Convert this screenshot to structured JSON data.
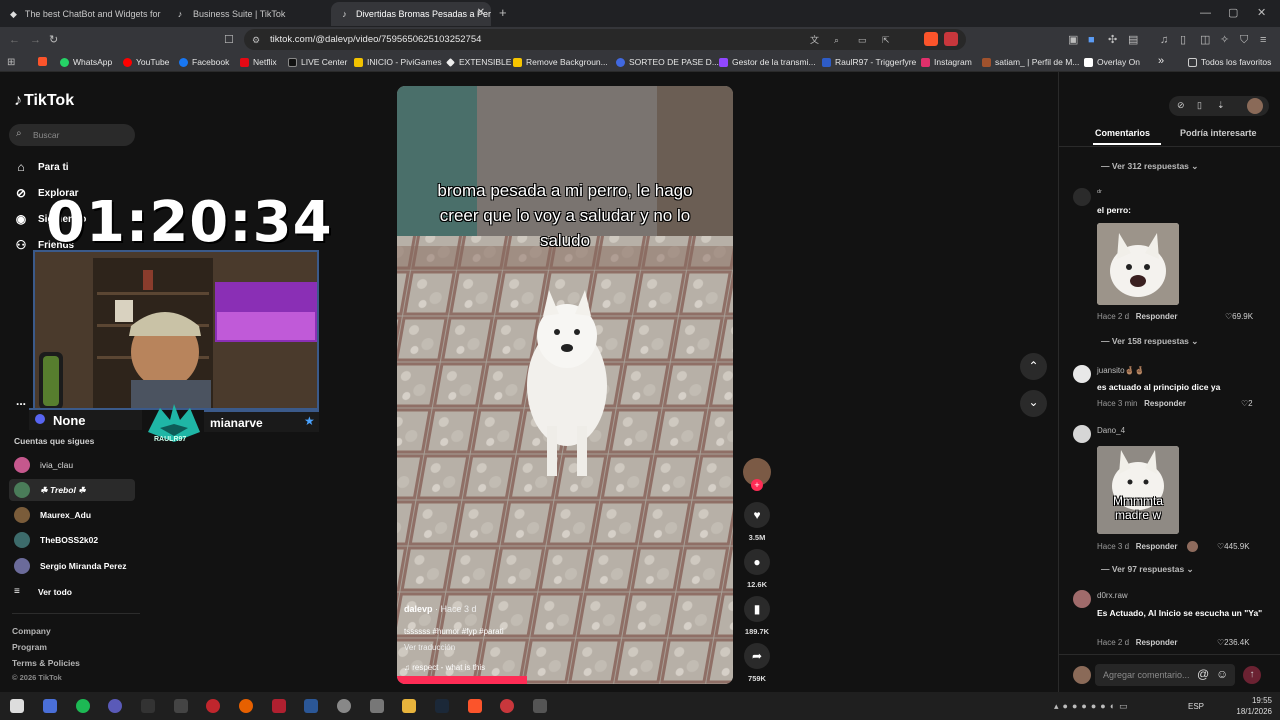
{
  "browser": {
    "tabs": [
      {
        "title": "The best ChatBot and Widgets for Ki",
        "icon": "diamond-icon"
      },
      {
        "title": "Business Suite | TikTok",
        "icon": "tiktok-icon"
      },
      {
        "title": "Divertidas Bromas Pesadas a Per",
        "icon": "tiktok-icon"
      }
    ],
    "new_tab": "+",
    "url": "tiktok.com/@dalevp/video/7595650625103252754",
    "bookmarks": [
      {
        "label": "WhatsApp",
        "color": "#25d366"
      },
      {
        "label": "YouTube",
        "color": "#ff0000"
      },
      {
        "label": "Facebook",
        "color": "#1877f2"
      },
      {
        "label": "Netflix",
        "color": "#e50914"
      },
      {
        "label": "LIVE Center",
        "color": "#000000"
      },
      {
        "label": "INICIO - PiviGames",
        "color": "#f2c200"
      },
      {
        "label": "EXTENSIBLE",
        "color": "#ffffff"
      },
      {
        "label": "Remove Backgroun...",
        "color": "#f7c500"
      },
      {
        "label": "SORTEO DE PASE D...",
        "color": "#4169e1"
      },
      {
        "label": "Gestor de la transmi...",
        "color": "#9147ff"
      },
      {
        "label": "RaulR97 - Triggerfyre",
        "color": "#2e5cc7"
      },
      {
        "label": "Instagram",
        "color": "#e1306c"
      },
      {
        "label": "satiam_ | Perfil de M...",
        "color": "#a0522d"
      },
      {
        "label": "Overlay On",
        "color": "#ffffff"
      }
    ],
    "bookmarks_overflow": "»",
    "all_favorites": "Todos los favoritos"
  },
  "sidebar": {
    "logo": "TikTok",
    "search_placeholder": "Buscar",
    "nav": [
      {
        "label": "Para ti",
        "icon": "home-icon"
      },
      {
        "label": "Explorar",
        "icon": "compass-icon"
      },
      {
        "label": "Siguiendo",
        "icon": "following-icon"
      },
      {
        "label": "Friends",
        "icon": "friends-icon"
      }
    ],
    "more": "...",
    "following_header": "Cuentas que sigues",
    "following": [
      {
        "name": "ivia_clau",
        "color": "#c5588d"
      },
      {
        "name": "☘ Trebol ☘",
        "color": "#4a7c59"
      },
      {
        "name": "Maurex_Adu",
        "color": "#7a5c3a"
      },
      {
        "name": "TheBOSS2k02",
        "color": "#3d6b6b"
      },
      {
        "name": "Sergio Miranda Perez",
        "color": "#6b6b9a"
      }
    ],
    "see_all": "Ver todo",
    "footer": [
      "Company",
      "Program",
      "Terms & Policies"
    ],
    "copyright": "© 2026 TikTok"
  },
  "overlay": {
    "timer": "01:20:34",
    "left_name": "None",
    "right_name": "mianarve",
    "logo_text": "RAULR97"
  },
  "video": {
    "caption": "broma pesada a mi perro, le hago creer que lo voy a saludar y no lo saludo",
    "author": "dalevp",
    "time": "· Hace 3 d",
    "hashtags": "tssssss #humor #fyp #parati",
    "translate": "Ver traducción",
    "music": "♫ respect - what is this",
    "likes": "3.5M",
    "comments": "12.6K",
    "saves": "189.7K",
    "shares": "759K"
  },
  "comments": {
    "tabs": [
      "Comentarios",
      "Podría interesarte"
    ],
    "items": [
      {
        "replies": "Ver 312 respuestas"
      },
      {
        "name": "ᵈʳ",
        "text": "el perro:",
        "time": "Hace 2 d",
        "reply": "Responder",
        "likes": "69.9K",
        "has_image": true,
        "image_caption": ""
      },
      {
        "replies": "Ver 158 respuestas"
      },
      {
        "name": "juansito🤞🏽🤞🏽",
        "text": "es actuado al principio dice ya",
        "time": "Hace 3 min",
        "reply": "Responder",
        "likes": "2"
      },
      {
        "name": "Dano_4",
        "text": "",
        "time": "Hace 3 d",
        "reply": "Responder",
        "likes": "445.9K",
        "has_image": true,
        "image_caption": "Mmmmta madre w"
      },
      {
        "replies": "Ver 97 respuestas"
      },
      {
        "name": "d0rx.raw",
        "text": "Es Actuado, Al Inicio se escucha un \"Ya\"",
        "time": "Hace 2 d",
        "reply": "Responder",
        "likes": "236.4K"
      }
    ],
    "input_placeholder": "Agregar comentario..."
  },
  "taskbar": {
    "lang": "ESP",
    "time": "19:55",
    "date": "18/1/2026"
  }
}
